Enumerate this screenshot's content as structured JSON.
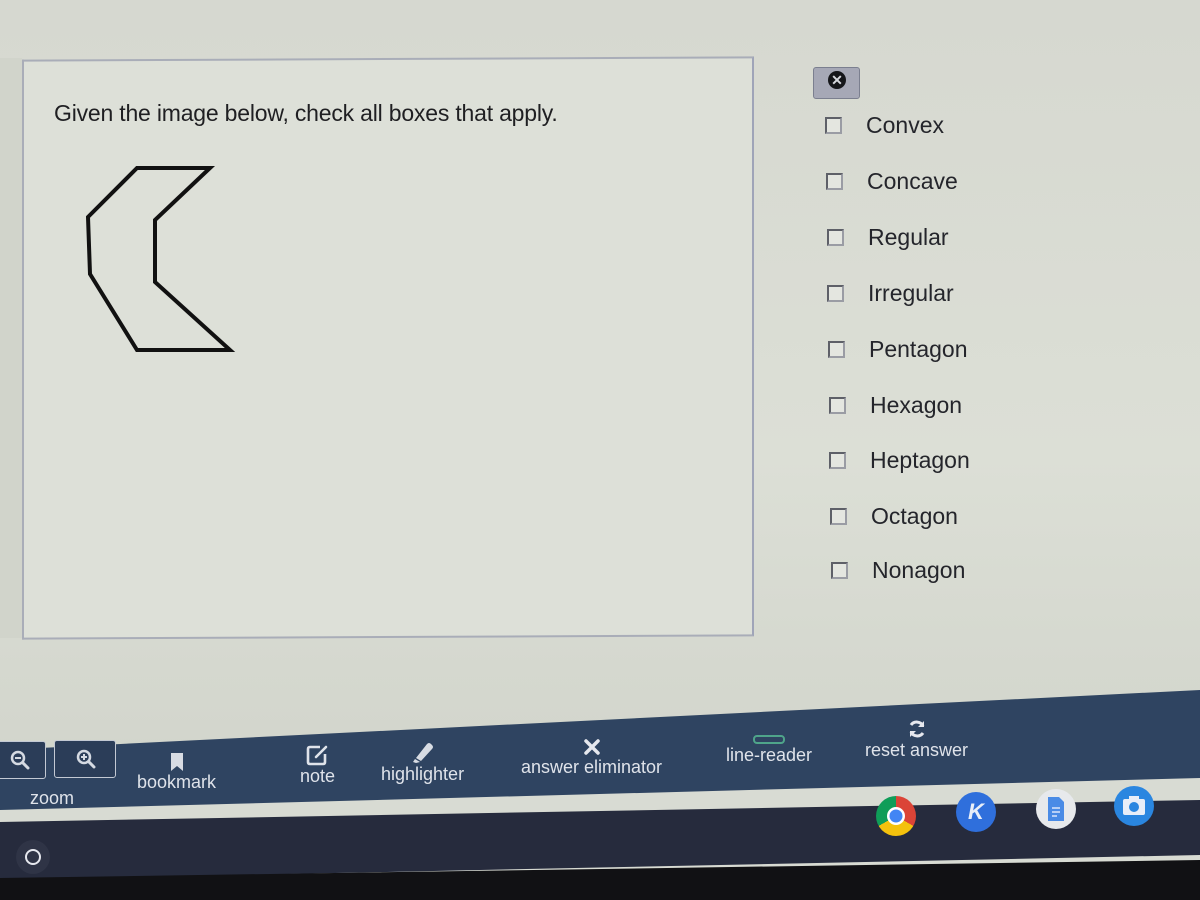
{
  "question": {
    "prompt": "Given the image below, check all boxes that apply.",
    "figure": "concave-octagon-chevron",
    "close_icon": "close-circle-icon"
  },
  "options": [
    {
      "label": "Convex",
      "checked": false
    },
    {
      "label": "Concave",
      "checked": false
    },
    {
      "label": "Regular",
      "checked": false
    },
    {
      "label": "Irregular",
      "checked": false
    },
    {
      "label": "Pentagon",
      "checked": false
    },
    {
      "label": "Hexagon",
      "checked": false
    },
    {
      "label": "Heptagon",
      "checked": false
    },
    {
      "label": "Octagon",
      "checked": false
    },
    {
      "label": "Nonagon",
      "checked": false
    }
  ],
  "toolbar": {
    "zoom": {
      "label": "zoom",
      "icons": [
        "zoom-out-icon",
        "zoom-in-icon"
      ]
    },
    "bookmark": {
      "label": "bookmark",
      "icon": "bookmark-icon"
    },
    "note": {
      "label": "note",
      "icon": "note-edit-icon"
    },
    "highlighter": {
      "label": "highlighter",
      "icon": "highlighter-icon"
    },
    "answer_eliminator": {
      "label": "answer eliminator",
      "icon": "x-icon"
    },
    "line_reader": {
      "label": "line-reader",
      "icon": "line-reader-icon"
    },
    "reset_answer": {
      "label": "reset answer",
      "icon": "refresh-icon"
    }
  },
  "shelf": {
    "launcher_icon": "launcher-circle-icon",
    "apps": [
      {
        "name": "chrome",
        "icon": "chrome-icon"
      },
      {
        "name": "k-app",
        "icon": "k-letter-icon",
        "letter": "K"
      },
      {
        "name": "docs",
        "icon": "docs-icon"
      },
      {
        "name": "camera",
        "icon": "camera-icon"
      }
    ]
  },
  "colors": {
    "toolbar_bg": "#2f4461",
    "shelf_bg": "#262b3d",
    "page_bg": "#dde0d8",
    "line_reader_accent": "#4fa58a"
  }
}
